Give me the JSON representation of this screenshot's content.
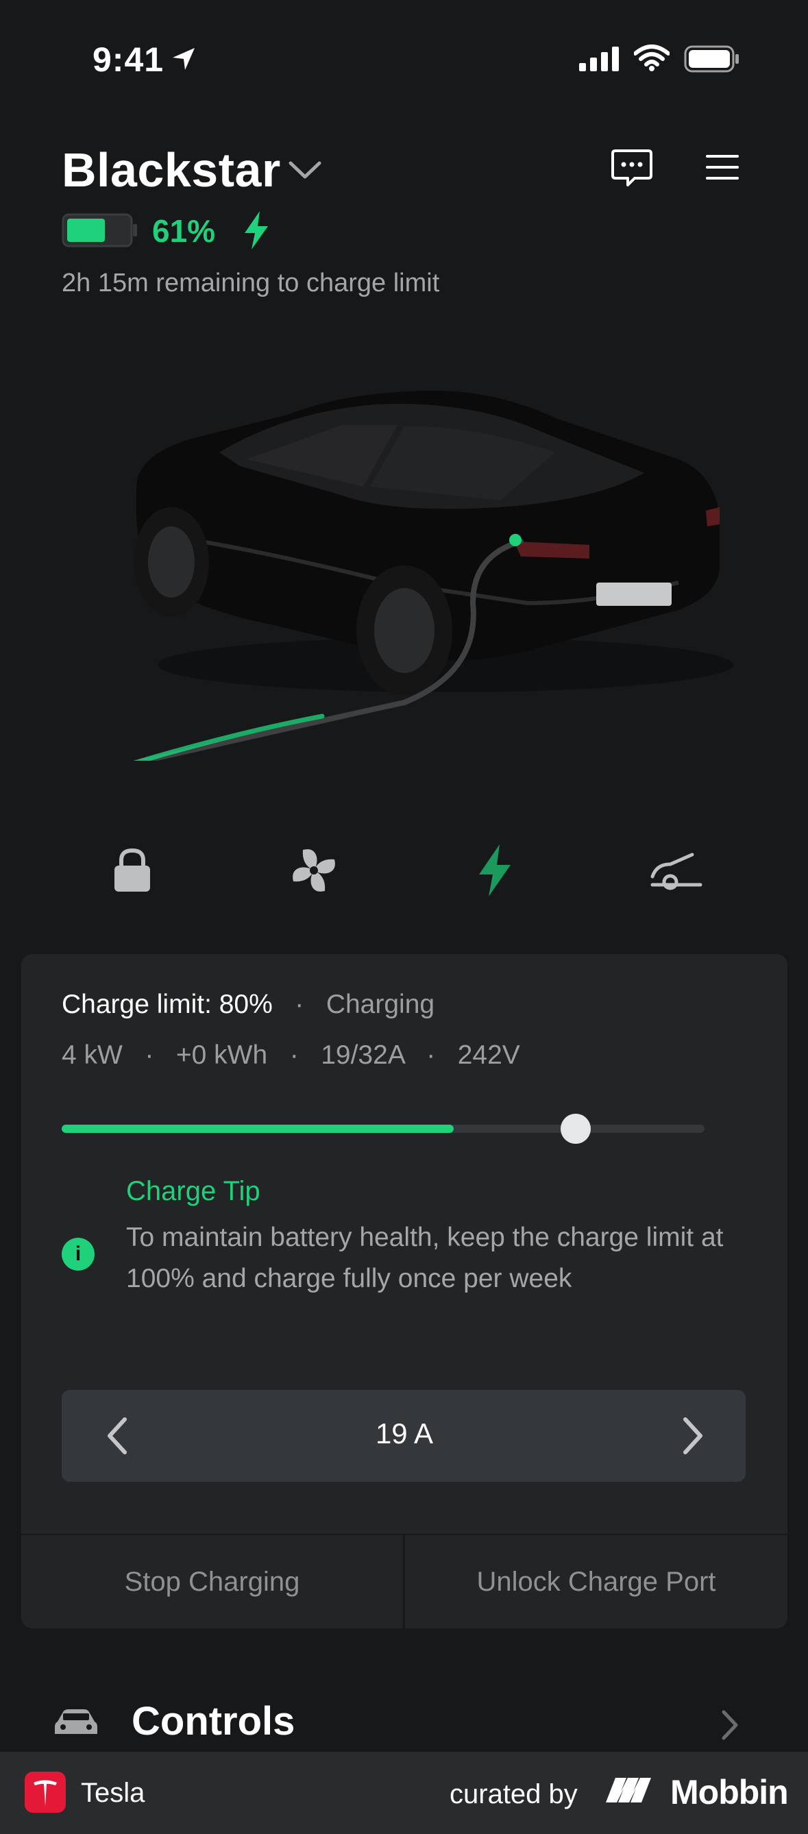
{
  "status_bar": {
    "time": "9:41"
  },
  "header": {
    "vehicle_name": "Blackstar"
  },
  "battery": {
    "percent_label": "61%",
    "level": 0.61,
    "remaining": "2h 15m remaining to charge limit"
  },
  "quick_actions": [
    {
      "name": "lock-icon",
      "active": false
    },
    {
      "name": "fan-icon",
      "active": false
    },
    {
      "name": "charge-icon",
      "active": true
    },
    {
      "name": "frunk-icon",
      "active": false
    }
  ],
  "charging": {
    "limit_label": "Charge limit: 80%",
    "status": "Charging",
    "stats": [
      "4 kW",
      "+0 kWh",
      "19/32A",
      "242V"
    ],
    "current_fill": 0.61,
    "limit_fill": 0.8
  },
  "tip": {
    "title": "Charge Tip",
    "body": "To maintain battery health, keep the charge limit at 100% and charge fully once per week"
  },
  "amps": {
    "value": "19 A"
  },
  "actions": {
    "stop": "Stop Charging",
    "unlock": "Unlock Charge Port"
  },
  "controls": {
    "label": "Controls"
  },
  "footer": {
    "app_name": "Tesla",
    "curated": "curated by",
    "brand": "Mobbin"
  },
  "colors": {
    "accent": "#1ed17a",
    "background": "#17181a",
    "panel": "#222426",
    "tesla_red": "#e31937"
  }
}
